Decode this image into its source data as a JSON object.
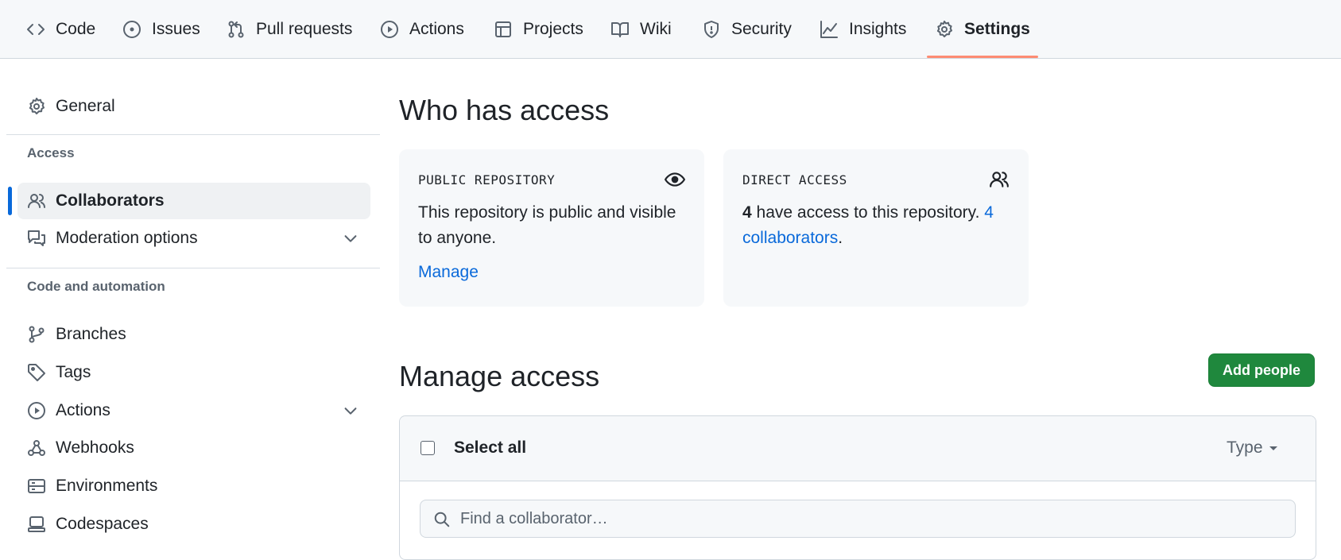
{
  "nav": {
    "tabs": [
      {
        "label": "Code",
        "icon": "code-icon"
      },
      {
        "label": "Issues",
        "icon": "issue-opened-icon"
      },
      {
        "label": "Pull requests",
        "icon": "git-pull-request-icon"
      },
      {
        "label": "Actions",
        "icon": "play-icon"
      },
      {
        "label": "Projects",
        "icon": "table-icon"
      },
      {
        "label": "Wiki",
        "icon": "book-icon"
      },
      {
        "label": "Security",
        "icon": "shield-icon"
      },
      {
        "label": "Insights",
        "icon": "graph-icon"
      },
      {
        "label": "Settings",
        "icon": "gear-icon",
        "active": true
      }
    ],
    "active_underline_color": "#fd8c73"
  },
  "sidebar": {
    "general": "General",
    "access_heading": "Access",
    "collaborators": "Collaborators",
    "moderation": "Moderation options",
    "code_heading": "Code and automation",
    "branches": "Branches",
    "tags": "Tags",
    "actions": "Actions",
    "webhooks": "Webhooks",
    "environments": "Environments",
    "codespaces": "Codespaces"
  },
  "main": {
    "who_title": "Who has access",
    "public_card": {
      "title": "PUBLIC REPOSITORY",
      "text": "This repository is public and visible to anyone.",
      "manage": "Manage"
    },
    "direct_card": {
      "title": "DIRECT ACCESS",
      "count": "4",
      "text": " have access to this repository. ",
      "link": "4 collaborators",
      "period": "."
    },
    "manage_title": "Manage access",
    "add_button": "Add people",
    "select_all": "Select all",
    "type_dropdown": "Type",
    "search_placeholder": "Find a collaborator…"
  },
  "colors": {
    "primary_button": "#1f883d",
    "link": "#0969da",
    "selected_marker": "#0969da"
  }
}
